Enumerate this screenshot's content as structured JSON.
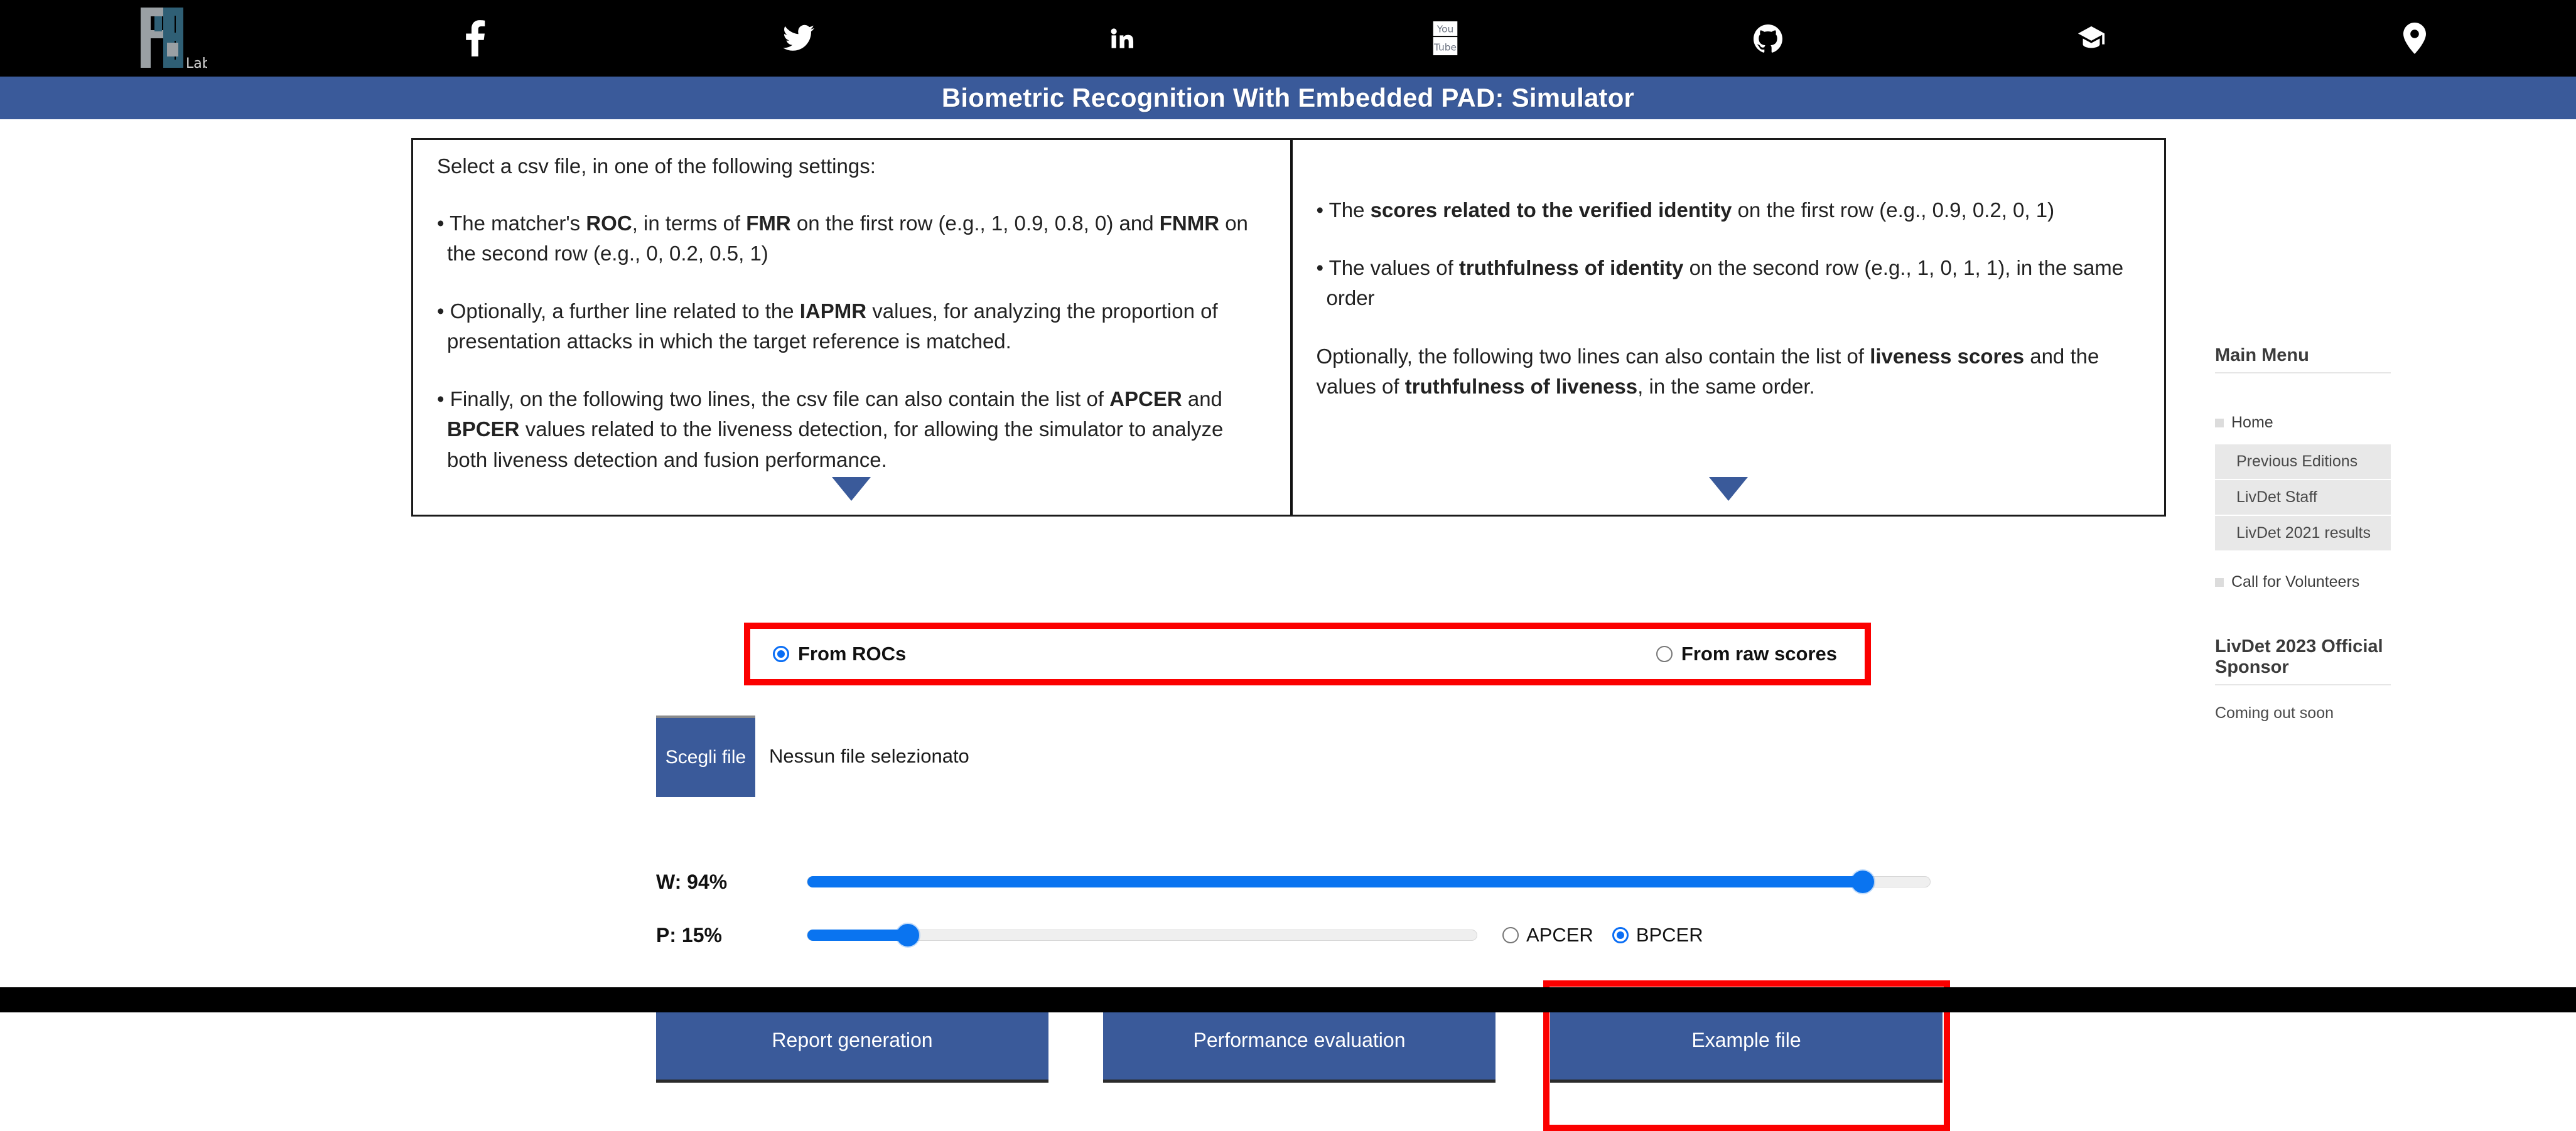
{
  "topbar": {
    "logo_text": "Lab",
    "social": [
      {
        "name": "facebook-icon",
        "label": "Facebook"
      },
      {
        "name": "twitter-icon",
        "label": "Twitter"
      },
      {
        "name": "linkedin-icon",
        "label": "LinkedIn"
      },
      {
        "name": "youtube-icon",
        "label": "YouTube"
      },
      {
        "name": "github-icon",
        "label": "GitHub"
      },
      {
        "name": "graduation-cap-icon",
        "label": "Google Scholar"
      },
      {
        "name": "location-pin-icon",
        "label": "Location"
      }
    ]
  },
  "banner": {
    "title": "Biometric Recognition With Embedded PAD: Simulator",
    "color": "#3a5a9a"
  },
  "instructions": {
    "lead": "Select a csv file, in one of the following settings:",
    "left_bullets": [
      "• The matcher's <b>ROC</b>, in terms of <b>FMR</b> on the first row (e.g., 1, 0.9, 0.8, 0) and <b>FNMR</b> on the second row (e.g., 0, 0.2, 0.5, 1)",
      "• Optionally, a further line related to the <b>IAPMR</b> values, for analyzing the proportion of presentation attacks in which the target reference is matched.",
      "• Finally, on the following two lines, the csv file can also contain the list of <b>APCER</b> and <b>BPCER</b> values related to the liveness detection, for allowing the simulator to analyze both liveness detection and fusion performance."
    ],
    "right_bullets": [
      "• The <b>scores related to the verified identity</b> on the first row (e.g., 0.9, 0.2, 0, 1)",
      "• The values of <b>truthfulness of identity</b> on the second row (e.g., 1, 0, 1, 1), in the same order"
    ],
    "right_para": "Optionally, the following two lines can also contain the list of <b>liveness scores</b> and the values of <b>truthfulness of liveness</b>, in the same order.",
    "expand_icon": "triangle-down-icon"
  },
  "source_mode": {
    "highlight_color": "#fb0000",
    "options": [
      {
        "label": "From ROCs",
        "checked": true
      },
      {
        "label": "From raw scores",
        "checked": false
      }
    ]
  },
  "file_input": {
    "button_label": "Scegli file",
    "file_name": "Nessun file selezionato"
  },
  "sliders": {
    "w": {
      "label": "W: 94%",
      "value": 94,
      "min": 0,
      "max": 100
    },
    "p": {
      "label": "P: 15%",
      "value": 15,
      "min": 0,
      "max": 100
    },
    "accent": "#0a74f0"
  },
  "error_metric": {
    "options": [
      {
        "label": "APCER",
        "checked": false
      },
      {
        "label": "BPCER",
        "checked": true
      }
    ]
  },
  "actions": [
    {
      "label": "Report generation",
      "highlighted": false
    },
    {
      "label": "Performance evaluation",
      "highlighted": false
    },
    {
      "label": "Example file",
      "highlighted": true
    }
  ],
  "sidebar": {
    "menu_title": "Main Menu",
    "top_items": [
      {
        "label": "Home"
      }
    ],
    "sub_items": [
      {
        "label": "Previous Editions"
      },
      {
        "label": "LivDet Staff"
      },
      {
        "label": "LivDet 2021 results"
      }
    ],
    "bottom_items": [
      {
        "label": "Call for Volunteers"
      }
    ],
    "sponsor_title": "LivDet 2023 Official Sponsor",
    "sponsor_text": "Coming out soon"
  }
}
